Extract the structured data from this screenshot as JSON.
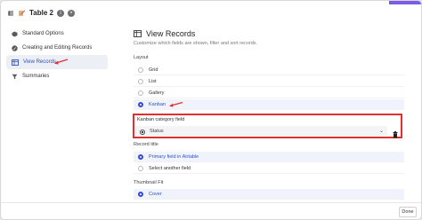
{
  "window": {
    "title": "Table 2"
  },
  "sidebar": {
    "items": [
      {
        "label": "Standard Options",
        "icon": "cube-icon"
      },
      {
        "label": "Creating and Editing Records",
        "icon": "edit-circle-icon"
      },
      {
        "label": "View Records",
        "icon": "table-view-icon",
        "active": true
      },
      {
        "label": "Summaries",
        "icon": "funnel-icon"
      }
    ]
  },
  "main": {
    "title": "View Records",
    "description": "Customize which fields are shown, filter and sort records.",
    "layout": {
      "label": "Layout",
      "options": [
        "Grid",
        "List",
        "Gallery",
        "Kanban"
      ],
      "selected": "Kanban"
    },
    "kanban_field": {
      "label": "Kanban category field",
      "value": "Status"
    },
    "record_title": {
      "label": "Record title",
      "options": [
        "Primary field in Airtable",
        "Select another field"
      ],
      "selected": "Primary field in Airtable"
    },
    "thumbnail_fit": {
      "label": "Thumbnail Fit",
      "options": [
        "Cover"
      ],
      "selected": "Cover"
    }
  },
  "footer": {
    "done_label": "Done"
  },
  "colors": {
    "accent": "#2f4bd6",
    "highlight": "#e03030",
    "arrow": "#e03030"
  }
}
